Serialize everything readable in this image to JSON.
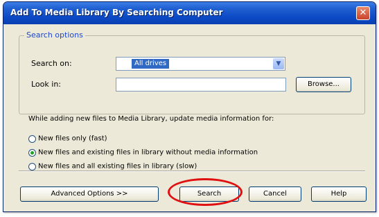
{
  "window": {
    "title": "Add To Media Library By Searching Computer",
    "close_glyph": "✕"
  },
  "search_options": {
    "legend": "Search options",
    "search_on_label": "Search on:",
    "search_on_value": "All drives",
    "look_in_label": "Look in:",
    "look_in_value": "",
    "browse_label": "Browse..."
  },
  "update": {
    "prompt": "While adding new files to Media Library, update media information for:",
    "options": [
      {
        "label": "New files only (fast)",
        "checked": false
      },
      {
        "label": "New files and existing files in library without media information",
        "checked": true
      },
      {
        "label": "New files and all existing files in library (slow)",
        "checked": false
      }
    ]
  },
  "buttons": {
    "advanced": "Advanced Options >>",
    "search": "Search",
    "cancel": "Cancel",
    "help": "Help"
  },
  "colors": {
    "annotation_ring": "#e01010",
    "titlebar": "#0b49c4"
  }
}
